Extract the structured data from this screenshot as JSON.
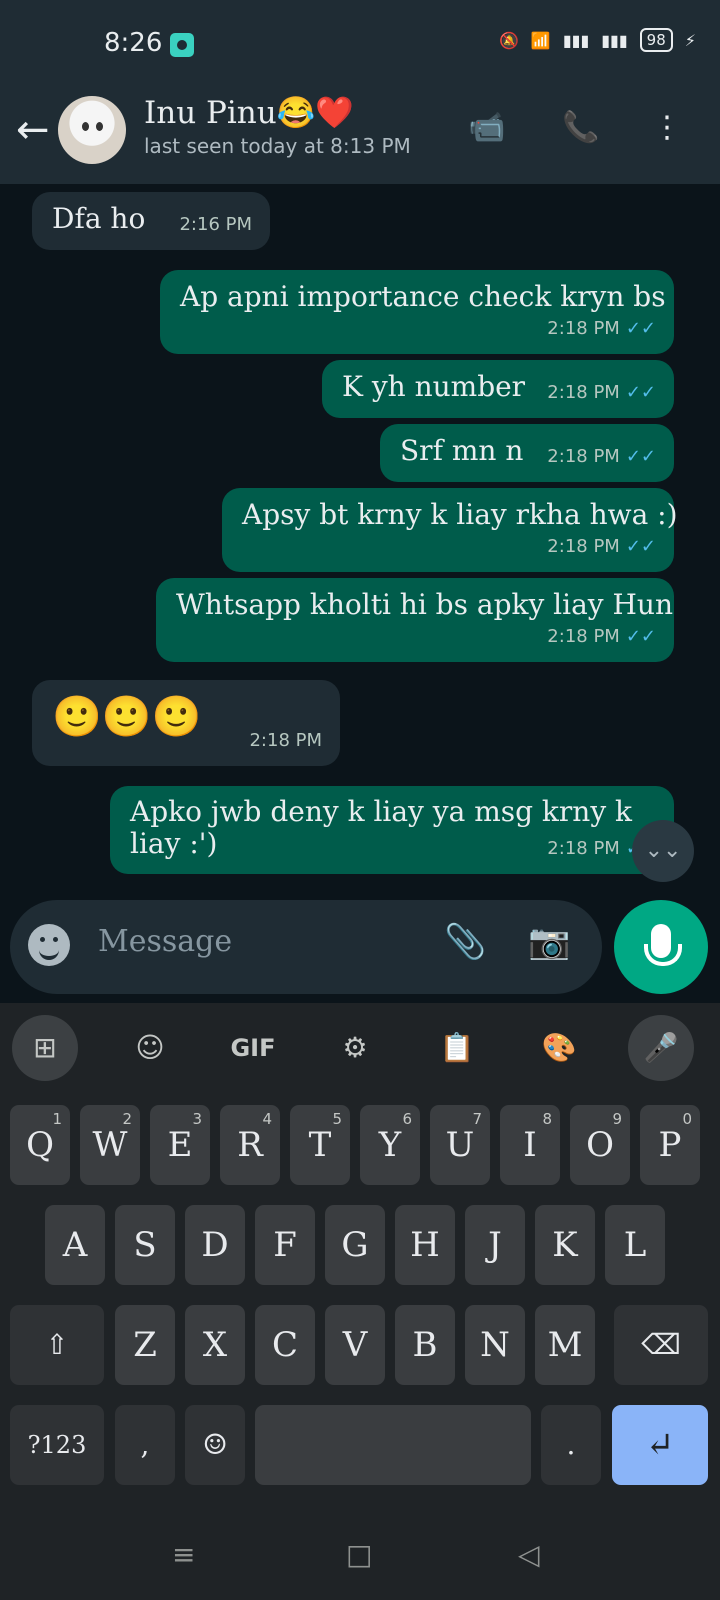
{
  "statusbar": {
    "time": "8:26",
    "battery": "98"
  },
  "header": {
    "contact_name": "Inu Pinu😂❤️",
    "last_seen": "last seen today at 8:13 PM"
  },
  "messages": [
    {
      "text": "Dfa ho",
      "time": "2:16 PM",
      "direction": "in"
    },
    {
      "text": "Ap apni importance check kryn bs",
      "time": "2:18 PM",
      "direction": "out"
    },
    {
      "text": "K yh number",
      "time": "2:18 PM",
      "direction": "out"
    },
    {
      "text": "Srf mn n",
      "time": "2:18 PM",
      "direction": "out"
    },
    {
      "text": "Apsy bt krny k liay rkha hwa :)",
      "time": "2:18 PM",
      "direction": "out"
    },
    {
      "text": "Whtsapp kholti hi bs apky liay Hun",
      "time": "2:18 PM",
      "direction": "out"
    },
    {
      "text": "🙂🙂🙂",
      "time": "2:18 PM",
      "direction": "in"
    },
    {
      "text": "Apko jwb deny k liay ya msg krny k\nliay :')",
      "time": "2:18 PM",
      "direction": "out"
    }
  ],
  "composer": {
    "placeholder": "Message"
  },
  "keyboard": {
    "toolbar": {
      "gif": "GIF"
    },
    "row1": [
      {
        "key": "Q",
        "hint": "1"
      },
      {
        "key": "W",
        "hint": "2"
      },
      {
        "key": "E",
        "hint": "3"
      },
      {
        "key": "R",
        "hint": "4"
      },
      {
        "key": "T",
        "hint": "5"
      },
      {
        "key": "Y",
        "hint": "6"
      },
      {
        "key": "U",
        "hint": "7"
      },
      {
        "key": "I",
        "hint": "8"
      },
      {
        "key": "O",
        "hint": "9"
      },
      {
        "key": "P",
        "hint": "0"
      }
    ],
    "row2": [
      "A",
      "S",
      "D",
      "F",
      "G",
      "H",
      "J",
      "K",
      "L"
    ],
    "row3": [
      "Z",
      "X",
      "C",
      "V",
      "B",
      "N",
      "M"
    ],
    "symbols": "?123",
    "comma": ",",
    "period": "."
  }
}
